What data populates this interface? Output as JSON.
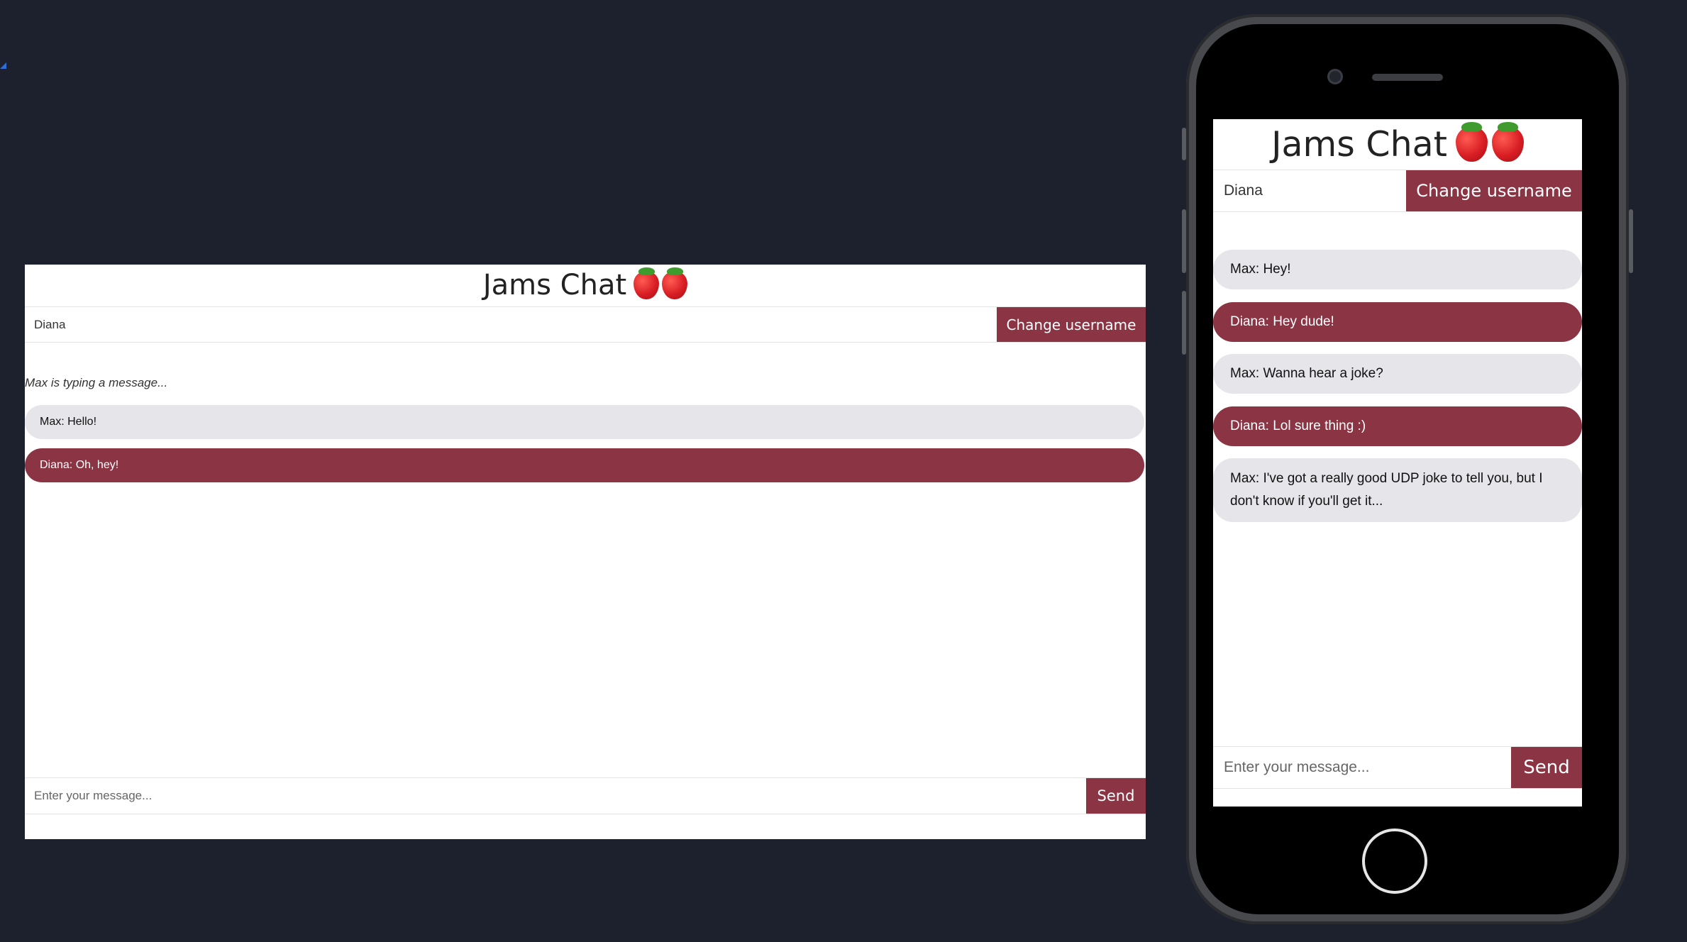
{
  "app": {
    "title": "Jams Chat",
    "title_icons": [
      "strawberry-icon",
      "strawberry-icon"
    ],
    "accent_color": "#8b3444",
    "other_bubble_color": "#e5e5ea",
    "background_color": "#1c212d"
  },
  "desktop": {
    "username_value": "Diana",
    "change_username_label": "Change username",
    "typing_indicator": "Max is typing a message...",
    "messages": [
      {
        "text": "Max: Hello!",
        "from": "other"
      },
      {
        "text": "Diana: Oh, hey!",
        "from": "mine"
      }
    ],
    "message_placeholder": "Enter your message...",
    "send_label": "Send"
  },
  "mobile": {
    "username_value": "Diana",
    "change_username_label": "Change username",
    "messages": [
      {
        "text": "Max: Hey!",
        "from": "other"
      },
      {
        "text": "Diana: Hey dude!",
        "from": "mine"
      },
      {
        "text": "Max: Wanna hear a joke?",
        "from": "other"
      },
      {
        "text": "Diana: Lol sure thing :)",
        "from": "mine"
      },
      {
        "text": "Max: I've got a really good UDP joke to tell you, but I don't know if you'll get it...",
        "from": "other"
      }
    ],
    "message_placeholder": "Enter your message...",
    "send_label": "Send"
  }
}
